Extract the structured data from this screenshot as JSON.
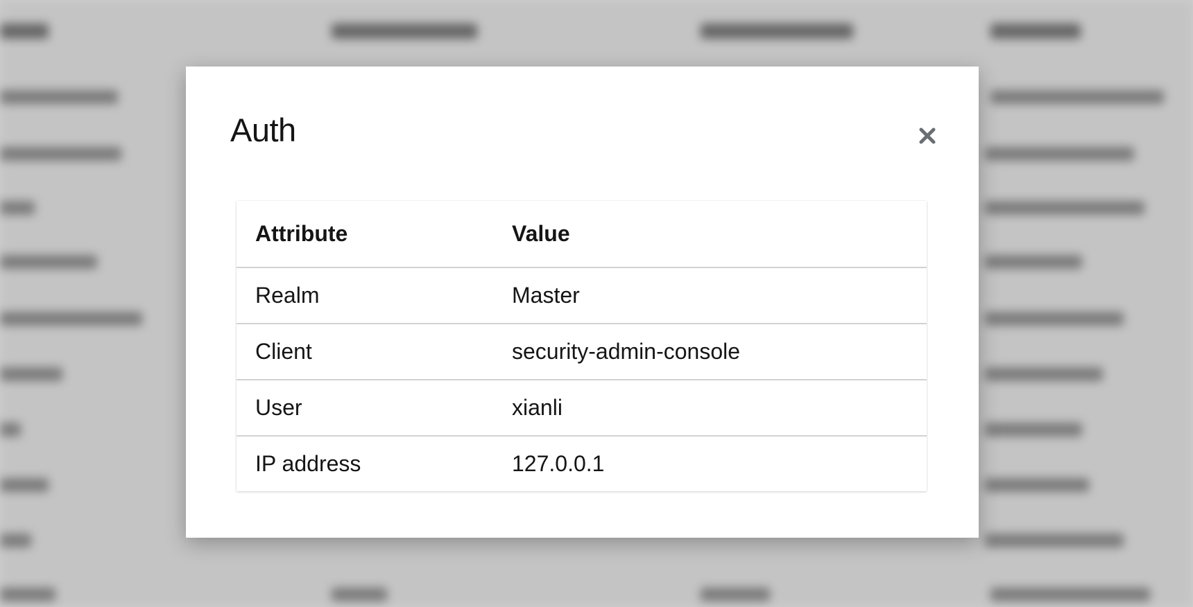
{
  "modal": {
    "title": "Auth",
    "close_icon": "close-icon"
  },
  "table": {
    "headers": [
      "Attribute",
      "Value"
    ],
    "rows": [
      {
        "attribute": "Realm",
        "value": "Master"
      },
      {
        "attribute": "Client",
        "value": "security-admin-console"
      },
      {
        "attribute": "User",
        "value": "xianli"
      },
      {
        "attribute": "IP address",
        "value": "127.0.0.1"
      }
    ]
  },
  "colors": {
    "overlay": "#cfcfcf",
    "modal_bg": "#ffffff",
    "text": "#151515",
    "close_icon": "#6a6e73",
    "row_border": "#d2d2d2"
  }
}
